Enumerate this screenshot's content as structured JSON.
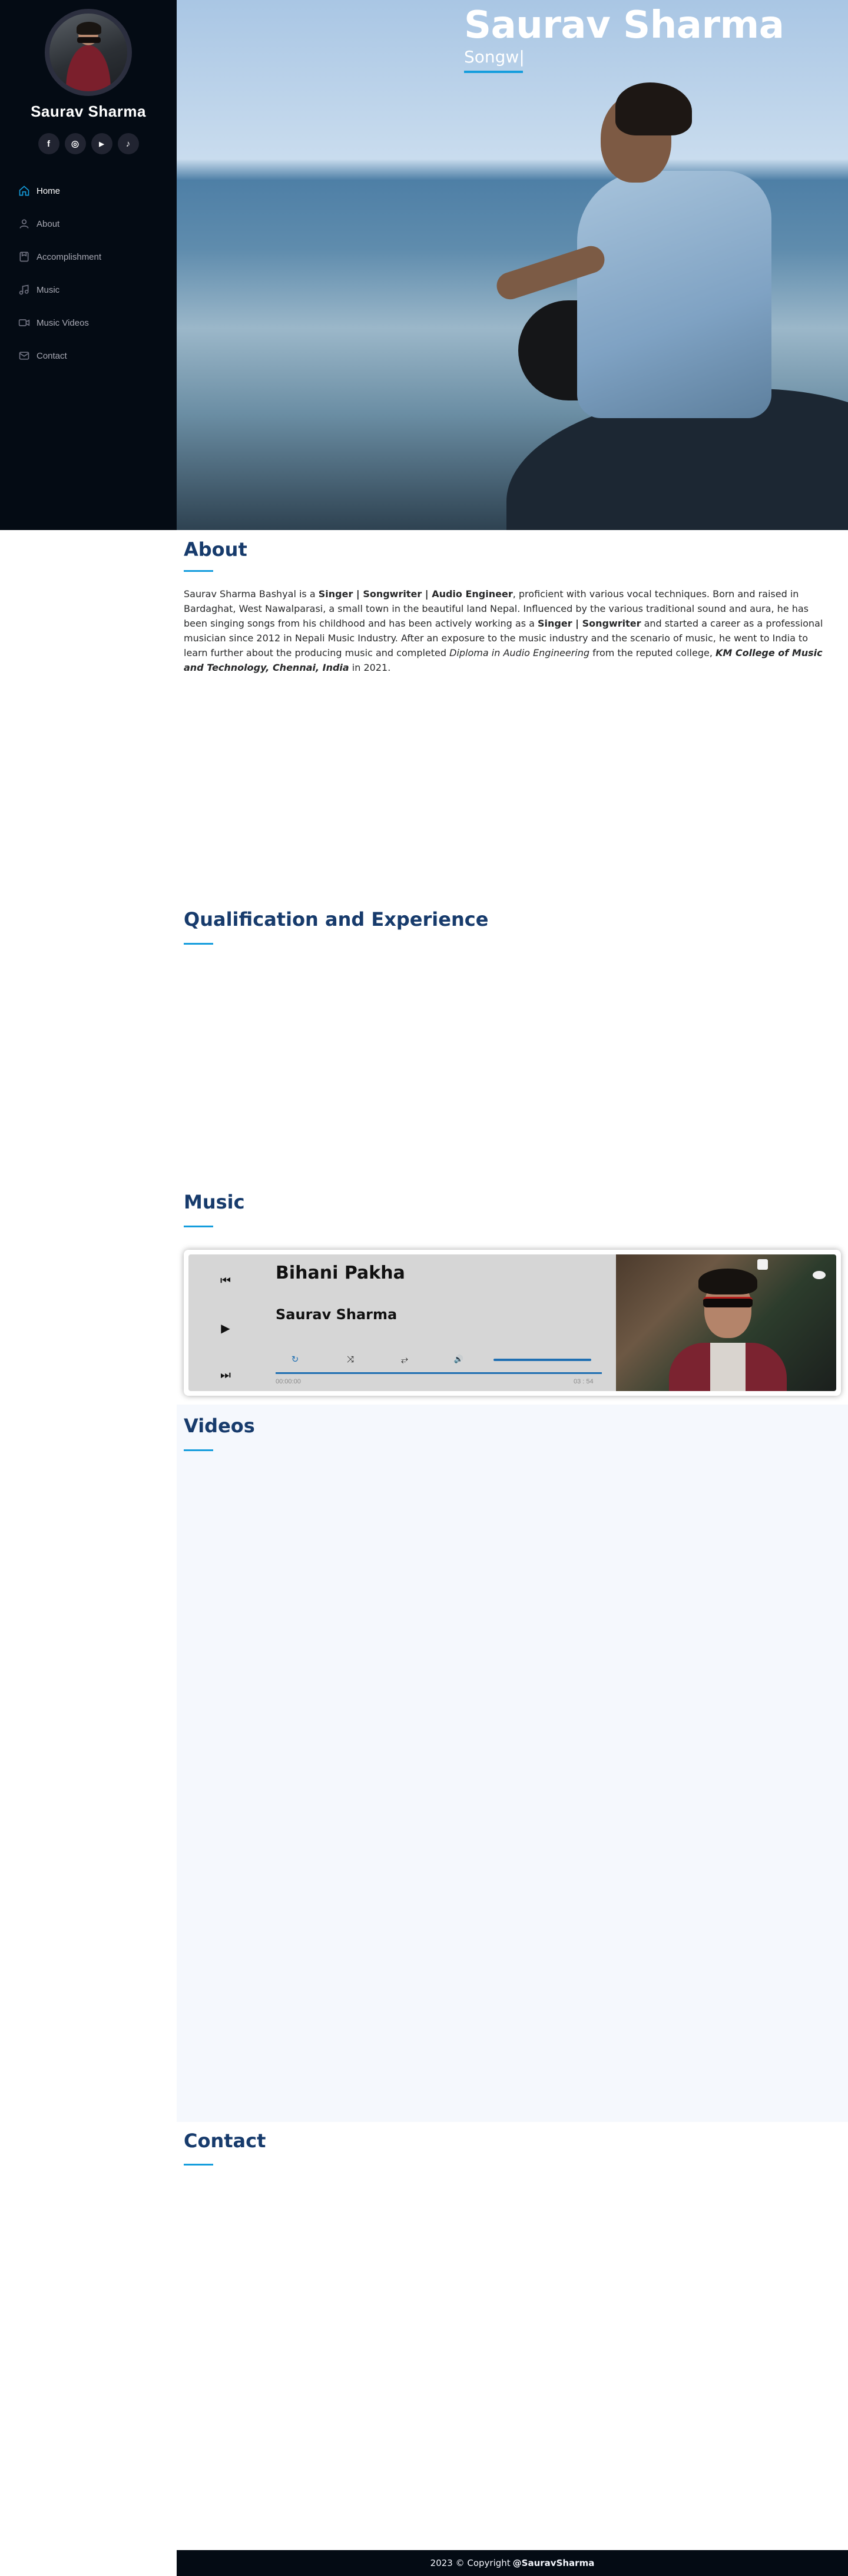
{
  "sidebar": {
    "profile_name": "Saurav Sharma",
    "socials": [
      {
        "icon": "facebook-icon",
        "glyph": "f"
      },
      {
        "icon": "instagram-icon",
        "glyph": "◎"
      },
      {
        "icon": "youtube-icon",
        "glyph": "▶"
      },
      {
        "icon": "tiktok-icon",
        "glyph": "♪"
      }
    ],
    "nav": [
      {
        "label": "Home",
        "icon": "home-icon",
        "active": true
      },
      {
        "label": "About",
        "icon": "user-icon",
        "active": false
      },
      {
        "label": "Accomplishment",
        "icon": "file-icon",
        "active": false
      },
      {
        "label": "Music",
        "icon": "music-icon",
        "active": false
      },
      {
        "label": "Music Videos",
        "icon": "video-icon",
        "active": false
      },
      {
        "label": "Contact",
        "icon": "envelope-icon",
        "active": false
      }
    ]
  },
  "hero": {
    "title": "Saurav Sharma",
    "subtitle": "Songw|"
  },
  "about": {
    "title": "About",
    "text": {
      "p1": "Saurav Sharma Bashyal is a ",
      "b1": "Singer | Songwriter | Audio Engineer",
      "p2": ", proficient with various vocal techniques. Born and raised in Bardaghat, West Nawalparasi, a small town in the beautiful land Nepal. Influenced by the various traditional sound and aura, he has been singing songs from his childhood and has been actively working as a ",
      "b2": "Singer | Songwriter",
      "p3": " and started a career as a professional musician since 2012 in Nepali Music Industry. After an exposure to the music industry and the scenario of music, he went to India to learn further about the producing music and completed ",
      "i1": "Diploma in Audio Engineering",
      "p4": " from the reputed college, ",
      "bi1": "KM College of Music and Technology, Chennai, India",
      "p5": " in 2021."
    }
  },
  "qualification": {
    "title": "Qualification and Experience"
  },
  "music": {
    "title": "Music",
    "player": {
      "song_title": "Bihani Pakha",
      "artist": "Saurav Sharma",
      "prev_glyph": "⏮",
      "play_glyph": "▶",
      "next_glyph": "⏭",
      "repeat_glyph": "↻",
      "shuffle_glyph": "⤨",
      "repeat_one_glyph": "⥂",
      "volume_glyph": "🔊",
      "current_time": "00:00:00",
      "duration": "03 : 54",
      "accent_color": "#1f6fb2"
    }
  },
  "videos": {
    "title": "Videos"
  },
  "contact": {
    "title": "Contact"
  },
  "footer": {
    "prefix": "2023 © Copyright",
    "name": "@SauravSharma"
  },
  "colors": {
    "sidebar_bg": "#040b14",
    "accent": "#149ddd",
    "heading": "#173b6c",
    "videos_bg": "#f5f8fd"
  }
}
